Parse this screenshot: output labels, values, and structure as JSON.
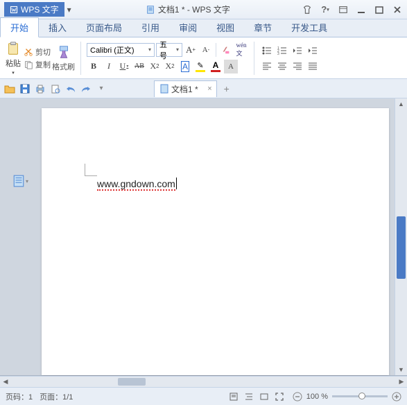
{
  "app": {
    "name": "WPS 文字",
    "doc_title": "文档1 * - WPS 文字"
  },
  "menu_tabs": [
    "开始",
    "插入",
    "页面布局",
    "引用",
    "审阅",
    "视图",
    "章节",
    "开发工具"
  ],
  "active_tab": 0,
  "clipboard": {
    "paste": "粘贴",
    "cut": "剪切",
    "copy": "复制",
    "brush": "格式刷"
  },
  "font": {
    "name": "Calibri (正文)",
    "size": "五号"
  },
  "doc_tab": {
    "label": "文档1 *"
  },
  "document": {
    "text": "www.gndown.com"
  },
  "status": {
    "page_label": "页码：",
    "page": "1",
    "pages_label": "页面：",
    "pages": "1/1",
    "zoom": "100 %"
  },
  "colors": {
    "accent": "#4a7ac5",
    "highlight": "#ffe600",
    "fontcolor": "#d02020"
  }
}
